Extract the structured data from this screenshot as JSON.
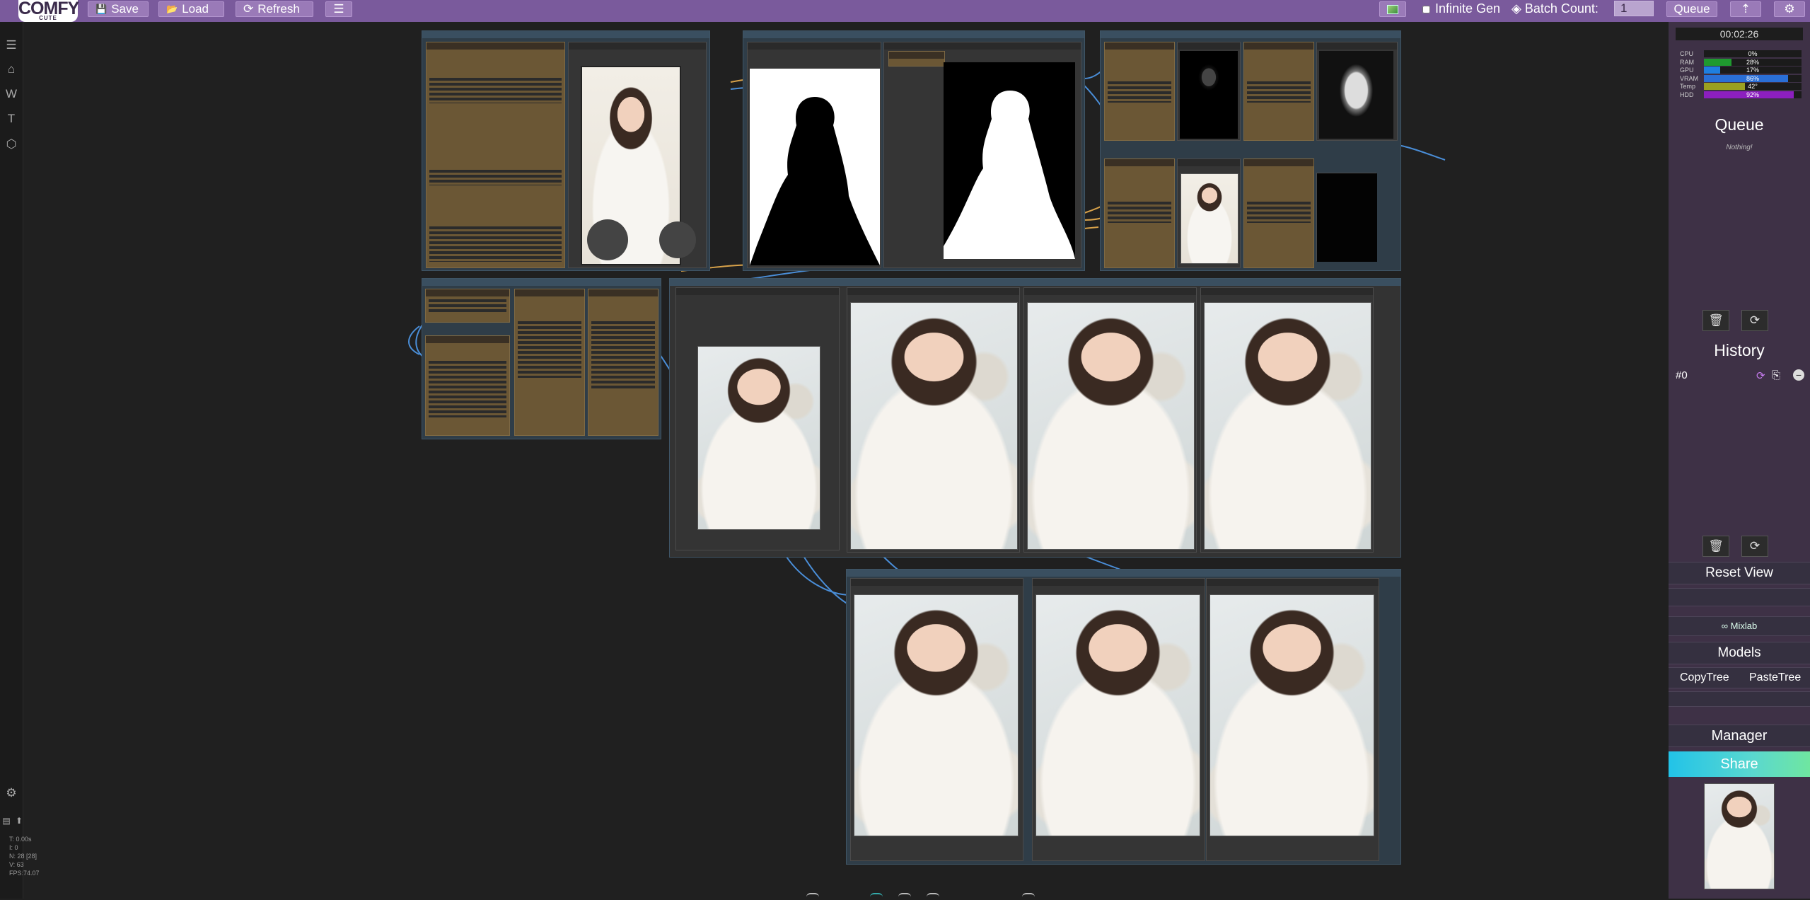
{
  "topbar": {
    "logo_text": "COMFY",
    "logo_sub": "CUTE",
    "save_label": "Save",
    "load_label": "Load",
    "refresh_label": "Refresh",
    "menu_icon": "hamburger-icon",
    "infinite_gen_label": "Infinite Gen",
    "infinite_gen_checked": false,
    "batch_count_label": "Batch Count:",
    "batch_count_value": "1",
    "queue_label": "Queue"
  },
  "leftbar": {
    "icons": [
      "hamburger-icon",
      "home-icon",
      "w-icon",
      "t-icon",
      "cube-icon"
    ],
    "letter_w": "W",
    "letter_t": "T"
  },
  "stats": {
    "t": "T: 0.00s",
    "i": "I: 0",
    "n": "N: 28 [28]",
    "v": "V: 63",
    "fps": "FPS:74.07"
  },
  "monitor": {
    "timer": "00:02:26",
    "rows": [
      {
        "label": "CPU",
        "value": "0%",
        "percent": 0,
        "color": "#3aa53a"
      },
      {
        "label": "RAM",
        "value": "28%",
        "percent": 28,
        "color": "#1f9a2f"
      },
      {
        "label": "GPU",
        "value": "17%",
        "percent": 17,
        "color": "#1e7fe0"
      },
      {
        "label": "VRAM",
        "value": "86%",
        "percent": 86,
        "color": "#2a6fd6"
      },
      {
        "label": "Temp",
        "value": "42°",
        "percent": 42,
        "color": "#9aa020"
      },
      {
        "label": "HDD",
        "value": "92%",
        "percent": 92,
        "color": "#8c1fbf"
      }
    ]
  },
  "queue": {
    "title": "Queue",
    "empty_text": "Nothing!"
  },
  "history": {
    "title": "History",
    "items": [
      {
        "label": "#0"
      }
    ]
  },
  "right_panel": {
    "reset_view": "Reset View",
    "mixlab": "∞ Mixlab",
    "models": "Models",
    "copy_tree": "CopyTree",
    "paste_tree": "PasteTree",
    "manager": "Manager",
    "share": "Share"
  },
  "colors": {
    "accent": "#7a5a9c",
    "panel": "#3e3146",
    "canvas": "#202020",
    "group": "#2f3d48",
    "node_orange": "#6b5735"
  }
}
